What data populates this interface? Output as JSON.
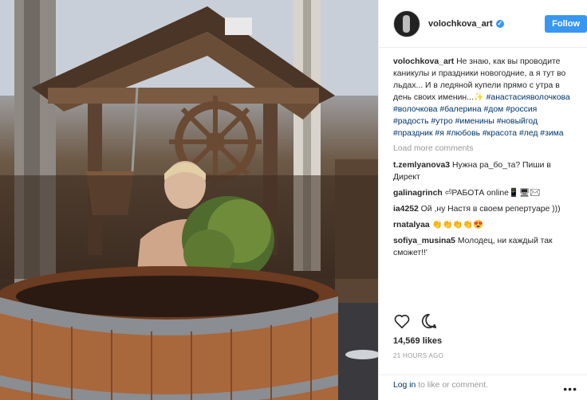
{
  "header": {
    "username": "volochkova_art",
    "follow_label": "Follow"
  },
  "caption": {
    "username": "volochkova_art",
    "text": "Не знаю, как вы проводите каникулы и праздники новогодние, а я тут во льдах... И в ледяной купели прямо с утра в день своих именин...✨",
    "hashtags": "#анастасияволочкова #волочкова #балерина #дом #россия #радость #утро #именины #новыйгод #праздник #я #любовь #красота #лед #зима"
  },
  "load_more_label": "Load more comments",
  "comments": [
    {
      "user": "t.zemlyanova3",
      "text": "Нужна ра_бо_та? Пиши в Директ"
    },
    {
      "user": "galinagrinch",
      "text": "⏎РАБОТА online📱🖥✉"
    },
    {
      "user": "ia4252",
      "text": "Ой ,ну Настя в своем репертуаре )))"
    },
    {
      "user": "rnatalyaa",
      "text": "👏👏👏👏😍"
    },
    {
      "user": "sofiya_musina5",
      "text": "Молодец, ни каждый так сможет!!'"
    }
  ],
  "likes": "14,569 likes",
  "time": "21 HOURS AGO",
  "login": {
    "link": "Log in",
    "text": " to like or comment."
  },
  "more_options": "•••",
  "icons": [
    "heart-icon",
    "comment-icon",
    "verified-badge-icon"
  ],
  "colors": {
    "accent": "#3897f0",
    "tag": "#003569",
    "muted": "#999999"
  }
}
